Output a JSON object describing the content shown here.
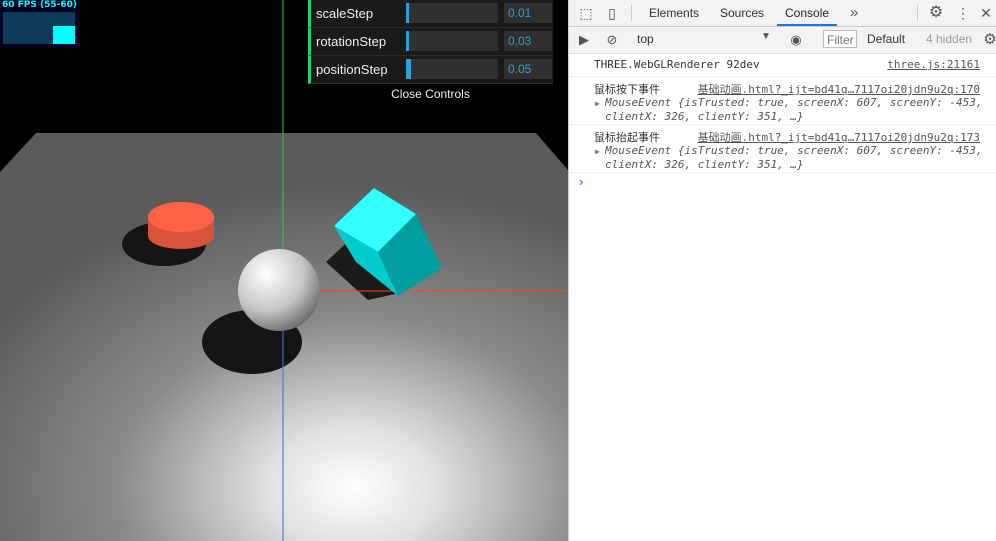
{
  "viewport": {
    "stats": {
      "fps_label": "60 FPS (55-60)"
    },
    "controls": [
      {
        "label": "scaleStep",
        "value": "0.01",
        "fill_fraction": 0.01
      },
      {
        "label": "rotationStep",
        "value": "0.03",
        "fill_fraction": 0.03
      },
      {
        "label": "positionStep",
        "value": "0.05",
        "fill_fraction": 0.05
      }
    ],
    "close_label": "Close Controls",
    "colors": {
      "plane": "#7a7a7a",
      "cylinder": "#ff6347",
      "cube": "#00eeee",
      "sphere": "#dddddd",
      "axis_x": "#ff4500",
      "axis_y": "#32cd32",
      "axis_z": "#4169e1"
    }
  },
  "devtools": {
    "tabs": [
      "Elements",
      "Sources",
      "Console"
    ],
    "active_tab": "Console",
    "more_tabs_icon": "chevron-double-right-icon",
    "context": "top",
    "filter_placeholder": "Filter",
    "levels": "Default",
    "hidden_count": "4 hidden",
    "logs": [
      {
        "message": "THREE.WebGLRenderer 92dev",
        "source": "three.js:21161"
      },
      {
        "message": "鼠标按下事件",
        "source": "基础动画.html?_ijt=bd41q…7117oi20jdn9u2q:170",
        "object_line1": "MouseEvent {isTrusted: true, screenX: 607, screenY: -453,",
        "object_line2": "clientX: 326, clientY: 351, …}"
      },
      {
        "message": "鼠标抬起事件",
        "source": "基础动画.html?_ijt=bd41q…7117oi20jdn9u2q:173",
        "object_line1": "MouseEvent {isTrusted: true, screenX: 607, screenY: -453,",
        "object_line2": "clientX: 326, clientY: 351, …}"
      }
    ],
    "prompt_symbol": "›"
  }
}
